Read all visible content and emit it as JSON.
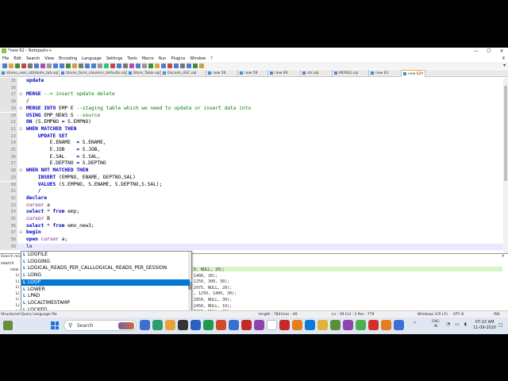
{
  "window": {
    "title": "*new 62 - Notepad++",
    "controls": [
      "—",
      "☐",
      "✕"
    ]
  },
  "menu": [
    "File",
    "Edit",
    "Search",
    "View",
    "Encoding",
    "Language",
    "Settings",
    "Tools",
    "Macro",
    "Run",
    "Plugins",
    "Window",
    "?"
  ],
  "menu_close": "X",
  "toolbar": {
    "icon_colors": [
      "#4a7fd0",
      "#e7a33b",
      "#3b8f3b",
      "#c44",
      "#777",
      "#4a7fd0",
      "#b04ab8",
      "#999",
      "#4a7fd0",
      "#4a7fd0",
      "#3b8f3b",
      "#c9a33b",
      "#777",
      "#4a7fd0",
      "#4a7fd0",
      "#999",
      "#2c7",
      "#c44",
      "#4a7fd0",
      "#777",
      "#b04ab8",
      "#4a7fd0",
      "#999",
      "#3b8f3b",
      "#e7a33b",
      "#4a7fd0",
      "#c44",
      "#4a7fd0",
      "#777",
      "#4a7fd0",
      "#3b8f3b",
      "#c9a33b"
    ],
    "end_label": "▾"
  },
  "tabs": [
    {
      "label": "stores_user_attribute_tab.sql",
      "width": 75,
      "active": false
    },
    {
      "label": "stores_form_columns_defaults.sql",
      "width": 85,
      "active": false
    },
    {
      "label": "Store_Table.sql",
      "width": 43,
      "active": false
    },
    {
      "label": "Decode_ASC.sql",
      "width": 57,
      "active": false
    },
    {
      "label": "new 56",
      "width": 40,
      "active": false
    },
    {
      "label": "new 59",
      "width": 38,
      "active": false
    },
    {
      "label": "new 60",
      "width": 41,
      "active": false
    },
    {
      "label": "shl.sql",
      "width": 40,
      "active": false
    },
    {
      "label": "MERGE.sql",
      "width": 46,
      "active": false
    },
    {
      "label": "new 61",
      "width": 41,
      "active": false
    },
    {
      "label": "new 62",
      "width": 30,
      "active": true
    }
  ],
  "tab_close": "✕",
  "editor": {
    "lines": [
      {
        "n": "15",
        "fold": "",
        "parts": [
          {
            "t": "update",
            "c": "kw"
          }
        ]
      },
      {
        "n": "16",
        "fold": "",
        "parts": []
      },
      {
        "n": "17",
        "fold": "⊟",
        "parts": [
          {
            "t": "MERGE",
            "c": "kw"
          },
          {
            "t": " --> insert update delete",
            "c": "cm"
          }
        ]
      },
      {
        "n": "18",
        "fold": "",
        "parts": [
          {
            "t": "/",
            "c": "op"
          }
        ]
      },
      {
        "n": "19",
        "fold": "⊟",
        "parts": [
          {
            "t": "MERGE INTO",
            "c": "kw"
          },
          {
            "t": " EMP E ",
            "c": ""
          },
          {
            "t": "--staging table which we need to update or insert data into",
            "c": "cm"
          }
        ]
      },
      {
        "n": "20",
        "fold": "",
        "parts": [
          {
            "t": "USING",
            "c": "kw"
          },
          {
            "t": " EMP_NEW3 S ",
            "c": ""
          },
          {
            "t": "--source",
            "c": "cm"
          }
        ]
      },
      {
        "n": "21",
        "fold": "",
        "parts": [
          {
            "t": "ON",
            "c": "kw"
          },
          {
            "t": " (S.EMPNO ",
            "c": ""
          },
          {
            "t": "=",
            "c": "op"
          },
          {
            "t": " S.EMPNO)",
            "c": ""
          }
        ]
      },
      {
        "n": "22",
        "fold": "⊟",
        "parts": [
          {
            "t": "WHEN MATCHED THEN",
            "c": "kw"
          }
        ]
      },
      {
        "n": "23",
        "fold": "",
        "parts": [
          {
            "t": "    UPDATE SET",
            "c": "kw"
          }
        ]
      },
      {
        "n": "24",
        "fold": "",
        "parts": [
          {
            "t": "        E.ENAME  ",
            "c": ""
          },
          {
            "t": "=",
            "c": "op"
          },
          {
            "t": " S.ENAME,",
            "c": ""
          }
        ]
      },
      {
        "n": "25",
        "fold": "",
        "parts": [
          {
            "t": "        E.JOB    ",
            "c": ""
          },
          {
            "t": "=",
            "c": "op"
          },
          {
            "t": " S.JOB,",
            "c": ""
          }
        ]
      },
      {
        "n": "26",
        "fold": "",
        "parts": [
          {
            "t": "        E.SAL    ",
            "c": ""
          },
          {
            "t": "=",
            "c": "op"
          },
          {
            "t": " S.SAL,",
            "c": ""
          }
        ]
      },
      {
        "n": "27",
        "fold": "",
        "parts": [
          {
            "t": "        E.DEPTNO ",
            "c": ""
          },
          {
            "t": "=",
            "c": "op"
          },
          {
            "t": " S.DEPTNO",
            "c": ""
          }
        ]
      },
      {
        "n": "28",
        "fold": "⊟",
        "parts": [
          {
            "t": "WHEN NOT MATCHED THEN",
            "c": "kw"
          }
        ]
      },
      {
        "n": "29",
        "fold": "",
        "parts": [
          {
            "t": "    INSERT",
            "c": "kw"
          },
          {
            "t": " (EMPNO, ENAME, DEPTNO,SAL)",
            "c": ""
          }
        ]
      },
      {
        "n": "30",
        "fold": "",
        "parts": [
          {
            "t": "    VALUES",
            "c": "kw"
          },
          {
            "t": " (S.EMPNO, S.ENAME, S.DEPTNO,S.SAL);",
            "c": ""
          }
        ]
      },
      {
        "n": "31",
        "fold": "",
        "parts": [
          {
            "t": "    /",
            "c": "op"
          }
        ]
      },
      {
        "n": "32",
        "fold": "",
        "parts": [
          {
            "t": "declare",
            "c": "kw"
          }
        ]
      },
      {
        "n": "33",
        "fold": "",
        "parts": [
          {
            "t": "cursor",
            "c": "id"
          },
          {
            "t": " a",
            "c": ""
          }
        ]
      },
      {
        "n": "34",
        "fold": "",
        "parts": [
          {
            "t": "select",
            "c": "kw"
          },
          {
            "t": " * ",
            "c": ""
          },
          {
            "t": "from",
            "c": "kw"
          },
          {
            "t": " emp;",
            "c": ""
          }
        ]
      },
      {
        "n": "35",
        "fold": "",
        "parts": [
          {
            "t": "cursor",
            "c": "id"
          },
          {
            "t": " B",
            "c": ""
          }
        ]
      },
      {
        "n": "36",
        "fold": "",
        "parts": [
          {
            "t": "select",
            "c": "kw"
          },
          {
            "t": " * ",
            "c": ""
          },
          {
            "t": "from",
            "c": "kw"
          },
          {
            "t": " emo_new3;",
            "c": ""
          }
        ]
      },
      {
        "n": "37",
        "fold": "⊟",
        "parts": [
          {
            "t": "begin",
            "c": "kw"
          }
        ]
      },
      {
        "n": "38",
        "fold": "",
        "parts": [
          {
            "t": "open",
            "c": "kw"
          },
          {
            "t": " ",
            "c": ""
          },
          {
            "t": "cursor",
            "c": "id"
          },
          {
            "t": " a;",
            "c": ""
          }
        ]
      },
      {
        "n": "39",
        "fold": "",
        "parts": [
          {
            "t": "lo",
            "c": ""
          }
        ],
        "current": true
      }
    ]
  },
  "find_panel": {
    "title": "Search results",
    "close": "✕",
    "side_labels": [
      "search",
      "new"
    ],
    "rows": [
      "0, NULL, 20);",
      "1400, 30);",
      "1250, 300, 30);",
      "2975, NULL, 20);",
      ", 1250, 1400, 30);",
      "2850, NULL, 30);",
      "2450, NULL, 10);",
      "3000, NULL, 20);"
    ],
    "row_prefixes": [
      "Li",
      "Li",
      "Li",
      "Li",
      "Li",
      "Li",
      "Li"
    ]
  },
  "autocomplete": {
    "items": [
      {
        "icon": "L",
        "label": "LOGFILE",
        "selected": false
      },
      {
        "icon": "L",
        "label": "LOGGING",
        "selected": false
      },
      {
        "icon": "L",
        "label": "LOGICAL_READS_PER_CALLLOGICAL_READS_PER_SESSION",
        "selected": false
      },
      {
        "icon": "L",
        "label": "LONG",
        "selected": false
      },
      {
        "icon": "L",
        "label": "LOOP",
        "selected": true
      },
      {
        "icon": "L",
        "label": "LOWER",
        "selected": false
      },
      {
        "icon": "L",
        "label": "LPAD",
        "selected": false
      },
      {
        "icon": "L",
        "label": "LOCALTIMESTAMP",
        "selected": false
      },
      {
        "icon": "L",
        "label": "LOCKED",
        "selected": false
      }
    ]
  },
  "status": {
    "file_type": "Structured Query Language file",
    "length": "length : 784",
    "lines": "lines : 40",
    "position": "Ln : 39    Col : 3    Pos : 779",
    "eol": "Windows (CR LF)",
    "encoding": "UTF-8",
    "mode": "INS"
  },
  "taskbar": {
    "search_label": "Search",
    "search_icon": "⚲",
    "app_colors": [
      "#3c6fd1",
      "#2d9d6f",
      "#e8a33a",
      "#333333",
      "#2b5fc2",
      "#1f9a4f",
      "#d44a2d",
      "#3c6fd1",
      "#c62828",
      "#8e44ad",
      "#ffffff",
      "#c62828",
      "#e57c1f",
      "#0b7bd9",
      "#e3b23c",
      "#5b8d3a",
      "#8e44ad",
      "#4caf50",
      "#d32f2f",
      "#e57c1f",
      "#3c6fd1"
    ],
    "tray_chevron": "^",
    "lang_top": "ENG",
    "lang_bottom": "IN",
    "tray_icons": "◔ ▭ ◖",
    "time": "07:22 AM",
    "date": "11-09-2020",
    "notification_icon": "▢"
  }
}
